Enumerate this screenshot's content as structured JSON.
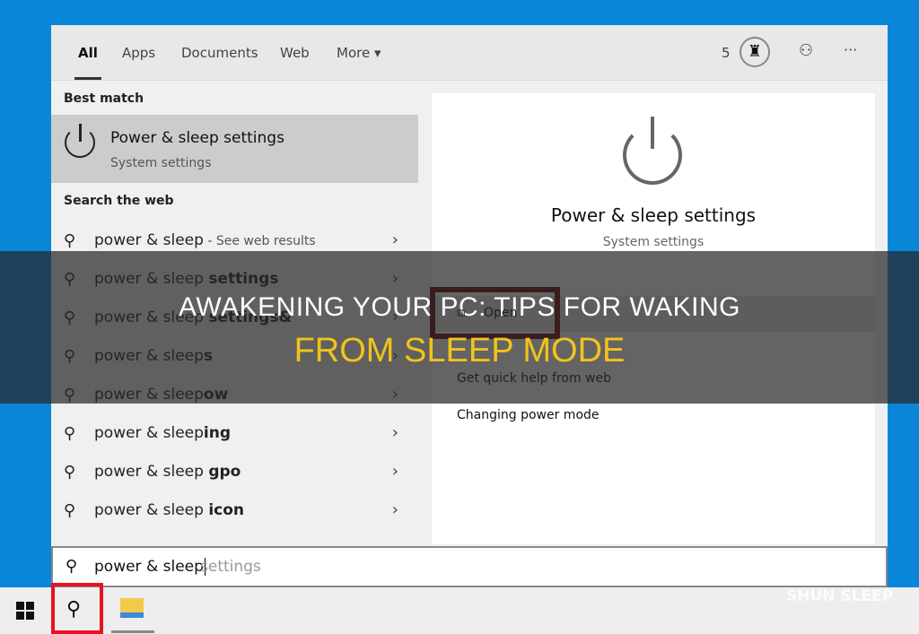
{
  "tabs": [
    {
      "label": "All"
    },
    {
      "label": "Apps"
    },
    {
      "label": "Documents"
    },
    {
      "label": "Web"
    },
    {
      "label": "More ▾"
    }
  ],
  "header": {
    "count": "5",
    "more": "···"
  },
  "left": {
    "best_match_heading": "Best match",
    "best_match": {
      "title": "Power & sleep settings",
      "subtitle": "System settings"
    },
    "web_heading": "Search the web",
    "suggestions": [
      {
        "base": "power & sleep",
        "bold": "",
        "suffix": " - See web results"
      },
      {
        "base": "power & sleep ",
        "bold": "settings",
        "suffix": ""
      },
      {
        "base": "power & sleep ",
        "bold": "settings&",
        "suffix": ""
      },
      {
        "base": "power & sleep",
        "bold": "s",
        "suffix": ""
      },
      {
        "base": "power & sleep",
        "bold": "ow",
        "suffix": ""
      },
      {
        "base": "power & sleep",
        "bold": "ing",
        "suffix": ""
      },
      {
        "base": "power & sleep ",
        "bold": "gpo",
        "suffix": ""
      },
      {
        "base": "power & sleep ",
        "bold": "icon",
        "suffix": ""
      }
    ]
  },
  "right": {
    "title": "Power & sleep settings",
    "subtitle": "System settings",
    "actions": [
      "Open",
      "Get quick help from web",
      "Changing power mode"
    ]
  },
  "search": {
    "typed": "power & sleep",
    "completion": "settings"
  },
  "banner": {
    "line1": "AWAKENING YOUR PC: TIPS FOR WAKING",
    "line2": "FROM SLEEP MODE"
  },
  "watermark": "SHUN SLEEP",
  "colors": {
    "desktop": "#0a86d9",
    "highlight": "#e81123",
    "banner_yellow": "#f2c31b"
  }
}
